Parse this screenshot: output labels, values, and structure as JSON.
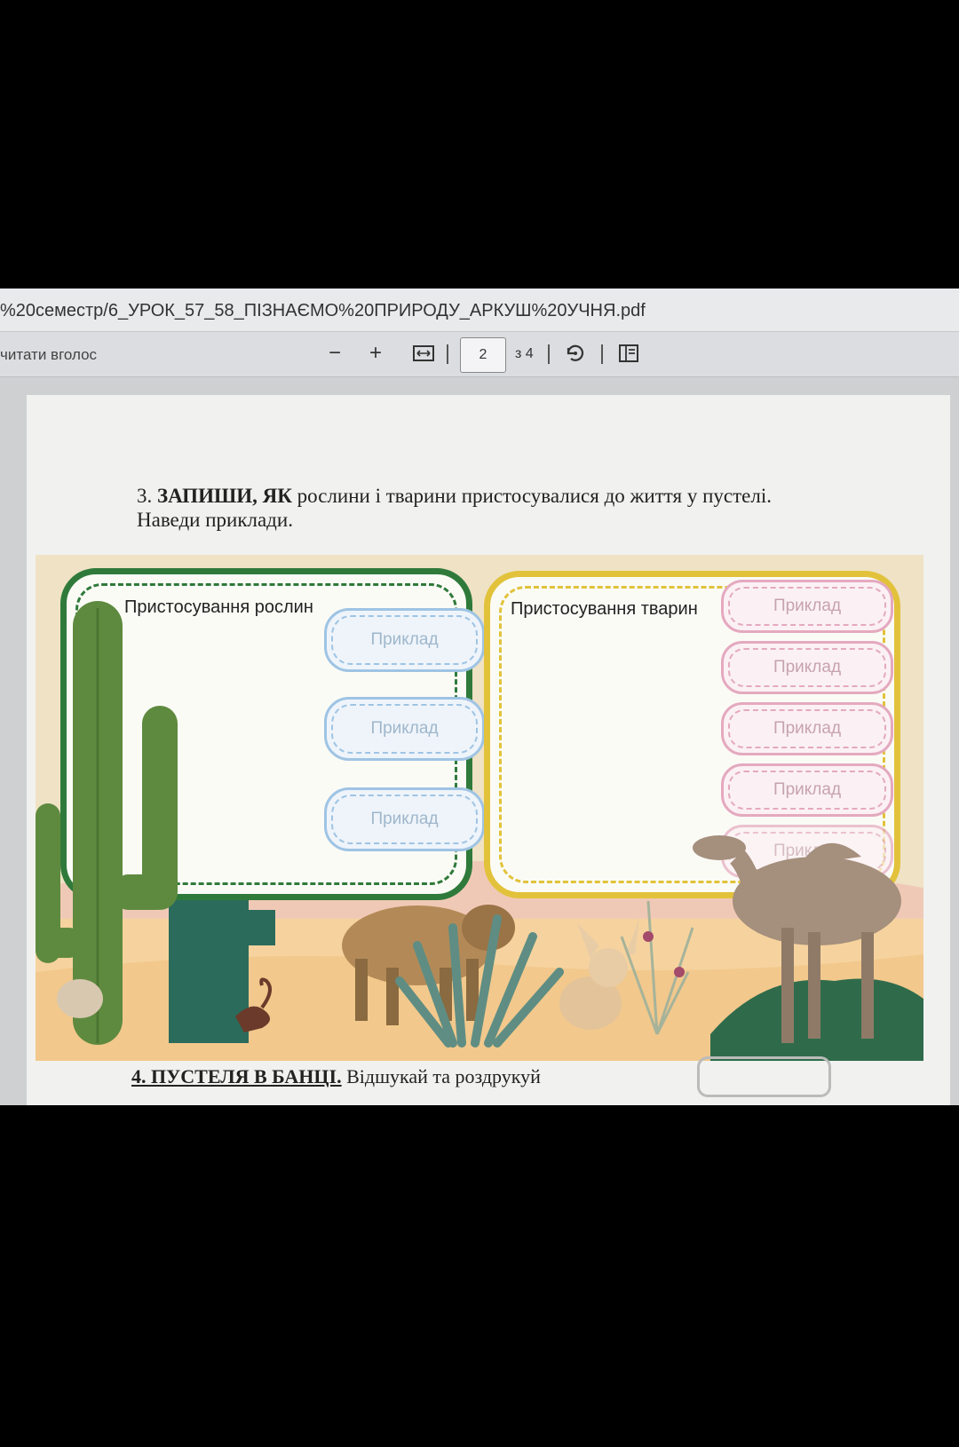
{
  "addressbar": {
    "path": "%20семестр/6_УРОК_57_58_ПІЗНАЄМО%20ПРИРОДУ_АРКУШ%20УЧНЯ.pdf"
  },
  "toolbar": {
    "read_aloud": "читати вголос",
    "zoom_out": "−",
    "zoom_in": "+",
    "fit_icon": "fit-width-icon",
    "current_page": "2",
    "total_pages": "з 4",
    "rotate_icon": "rotate-icon",
    "view_icon": "page-view-icon"
  },
  "task3": {
    "number": "3.",
    "bold_lead": "ЗАПИШИ, ЯК",
    "rest_line1": " рослини і тварини пристосувалися до життя у пустелі.",
    "line2": "Наведи приклади."
  },
  "worksheet": {
    "plants": {
      "heading": "Пристосування рослин",
      "examples": [
        "Приклад",
        "Приклад",
        "Приклад"
      ]
    },
    "animals": {
      "heading": "Пристосування тварин",
      "examples": [
        "Приклад",
        "Приклад",
        "Приклад",
        "Приклад",
        "Приклад"
      ]
    }
  },
  "task4": {
    "bold_lead": "4. ПУСТЕЛЯ В БАНЦІ.",
    "rest": " Відшукай та роздрукуй"
  },
  "colors": {
    "plants_frame": "#2f7a3a",
    "animals_frame": "#e2c23a",
    "blue_example": "#9fc4e4",
    "pink_example": "#e4a9bf"
  }
}
